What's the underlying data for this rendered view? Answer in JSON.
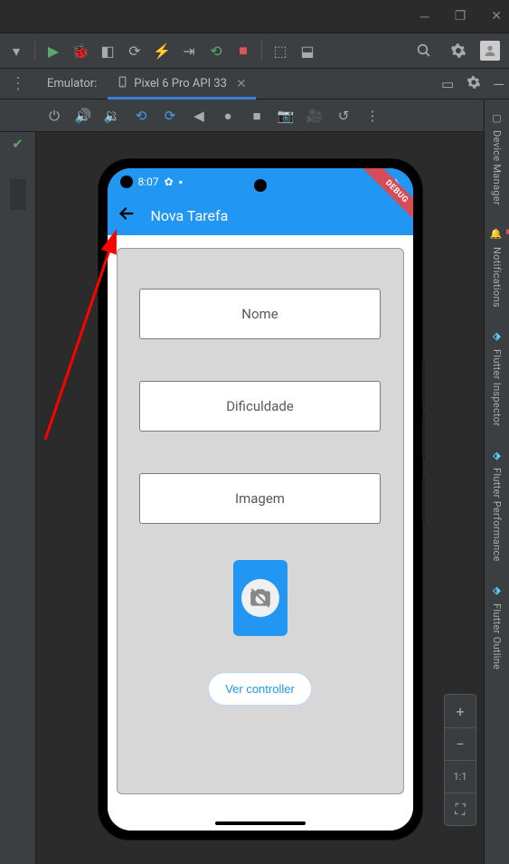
{
  "window": {
    "emulator_label": "Emulator:",
    "device_tab": "Pixel 6 Pro API 33"
  },
  "right_panels": {
    "device_manager": "Device Manager",
    "notifications": "Notifications",
    "flutter_inspector": "Flutter Inspector",
    "flutter_performance": "Flutter Performance",
    "flutter_outline": "Flutter Outline"
  },
  "zoom": {
    "ratio": "1:1"
  },
  "phone": {
    "status_time": "8:07",
    "debug_label": "DEBUG",
    "appbar_title": "Nova Tarefa",
    "fields": {
      "name_hint": "Nome",
      "difficulty_hint": "Dificuldade",
      "image_hint": "Imagem"
    },
    "button_label": "Ver controller"
  }
}
